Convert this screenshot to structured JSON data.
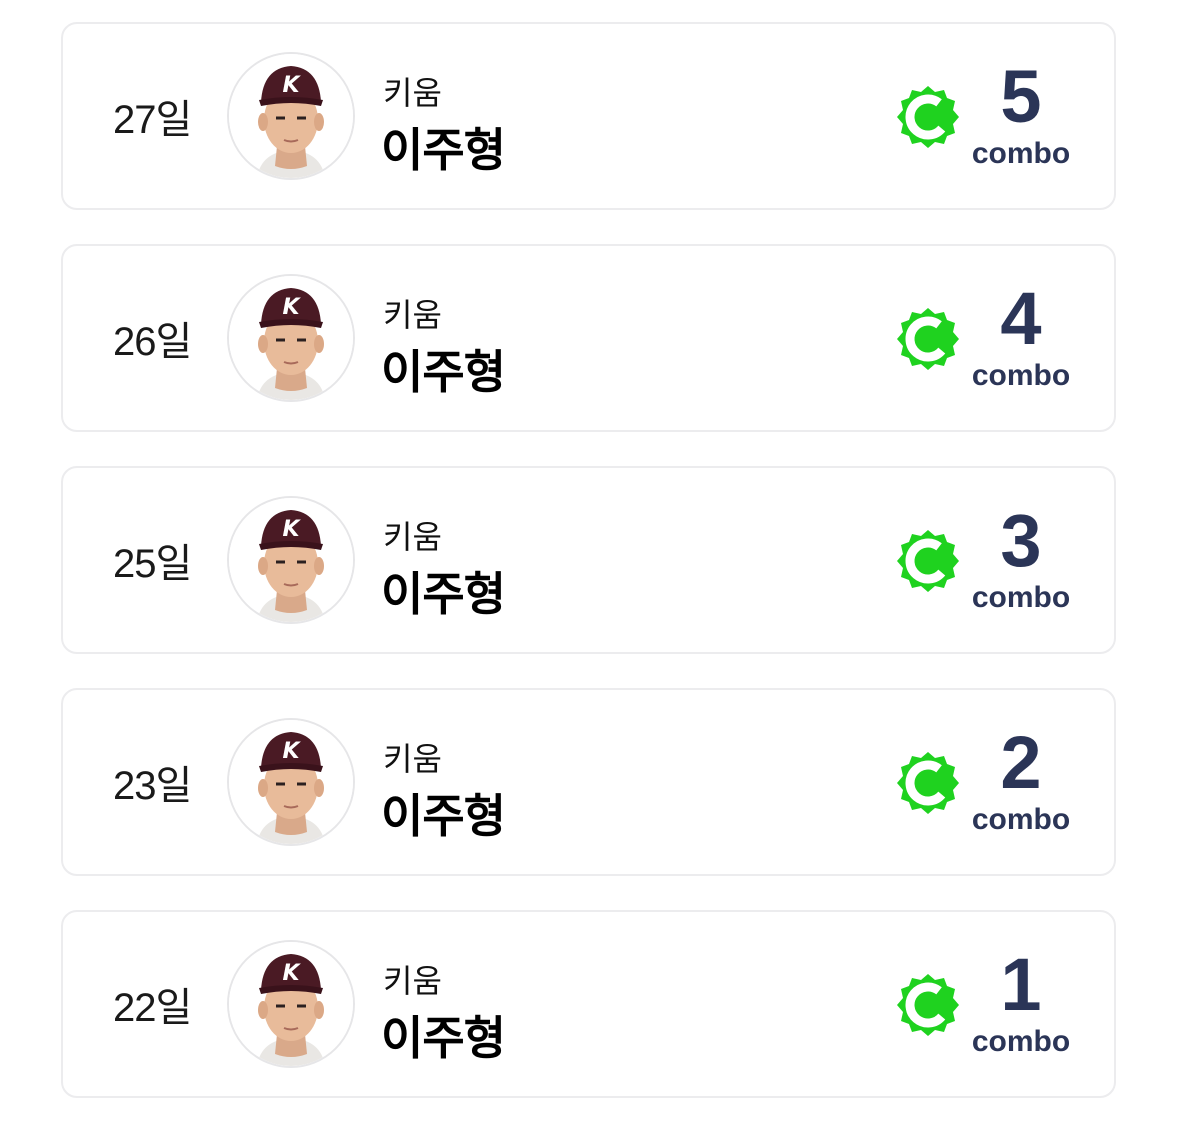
{
  "entries": [
    {
      "day": "27일",
      "team": "키움",
      "player": "이주형",
      "combo": "5",
      "combo_label": "combo"
    },
    {
      "day": "26일",
      "team": "키움",
      "player": "이주형",
      "combo": "4",
      "combo_label": "combo"
    },
    {
      "day": "25일",
      "team": "키움",
      "player": "이주형",
      "combo": "3",
      "combo_label": "combo"
    },
    {
      "day": "23일",
      "team": "키움",
      "player": "이주형",
      "combo": "2",
      "combo_label": "combo"
    },
    {
      "day": "22일",
      "team": "키움",
      "player": "이주형",
      "combo": "1",
      "combo_label": "combo"
    }
  ],
  "colors": {
    "combo_green": "#1fd21f",
    "combo_text": "#2b3557",
    "card_border": "#ececee",
    "cap": "#4a1a24"
  },
  "icons": {
    "combo": "combo-badge-icon",
    "avatar": "player-photo"
  }
}
